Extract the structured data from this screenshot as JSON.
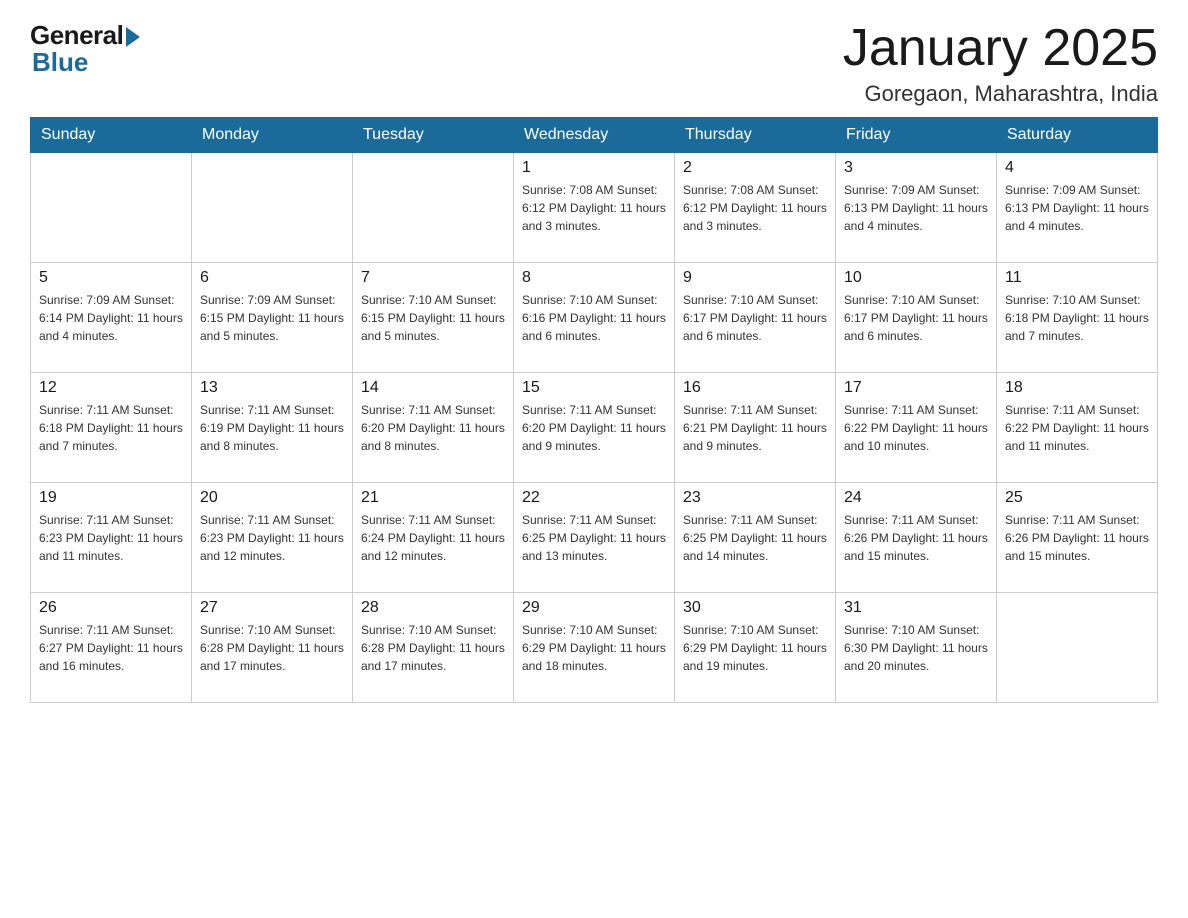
{
  "header": {
    "logo_general": "General",
    "logo_blue": "Blue",
    "title": "January 2025",
    "location": "Goregaon, Maharashtra, India"
  },
  "weekdays": [
    "Sunday",
    "Monday",
    "Tuesday",
    "Wednesday",
    "Thursday",
    "Friday",
    "Saturday"
  ],
  "weeks": [
    [
      {
        "day": "",
        "info": ""
      },
      {
        "day": "",
        "info": ""
      },
      {
        "day": "",
        "info": ""
      },
      {
        "day": "1",
        "info": "Sunrise: 7:08 AM\nSunset: 6:12 PM\nDaylight: 11 hours and 3 minutes."
      },
      {
        "day": "2",
        "info": "Sunrise: 7:08 AM\nSunset: 6:12 PM\nDaylight: 11 hours and 3 minutes."
      },
      {
        "day": "3",
        "info": "Sunrise: 7:09 AM\nSunset: 6:13 PM\nDaylight: 11 hours and 4 minutes."
      },
      {
        "day": "4",
        "info": "Sunrise: 7:09 AM\nSunset: 6:13 PM\nDaylight: 11 hours and 4 minutes."
      }
    ],
    [
      {
        "day": "5",
        "info": "Sunrise: 7:09 AM\nSunset: 6:14 PM\nDaylight: 11 hours and 4 minutes."
      },
      {
        "day": "6",
        "info": "Sunrise: 7:09 AM\nSunset: 6:15 PM\nDaylight: 11 hours and 5 minutes."
      },
      {
        "day": "7",
        "info": "Sunrise: 7:10 AM\nSunset: 6:15 PM\nDaylight: 11 hours and 5 minutes."
      },
      {
        "day": "8",
        "info": "Sunrise: 7:10 AM\nSunset: 6:16 PM\nDaylight: 11 hours and 6 minutes."
      },
      {
        "day": "9",
        "info": "Sunrise: 7:10 AM\nSunset: 6:17 PM\nDaylight: 11 hours and 6 minutes."
      },
      {
        "day": "10",
        "info": "Sunrise: 7:10 AM\nSunset: 6:17 PM\nDaylight: 11 hours and 6 minutes."
      },
      {
        "day": "11",
        "info": "Sunrise: 7:10 AM\nSunset: 6:18 PM\nDaylight: 11 hours and 7 minutes."
      }
    ],
    [
      {
        "day": "12",
        "info": "Sunrise: 7:11 AM\nSunset: 6:18 PM\nDaylight: 11 hours and 7 minutes."
      },
      {
        "day": "13",
        "info": "Sunrise: 7:11 AM\nSunset: 6:19 PM\nDaylight: 11 hours and 8 minutes."
      },
      {
        "day": "14",
        "info": "Sunrise: 7:11 AM\nSunset: 6:20 PM\nDaylight: 11 hours and 8 minutes."
      },
      {
        "day": "15",
        "info": "Sunrise: 7:11 AM\nSunset: 6:20 PM\nDaylight: 11 hours and 9 minutes."
      },
      {
        "day": "16",
        "info": "Sunrise: 7:11 AM\nSunset: 6:21 PM\nDaylight: 11 hours and 9 minutes."
      },
      {
        "day": "17",
        "info": "Sunrise: 7:11 AM\nSunset: 6:22 PM\nDaylight: 11 hours and 10 minutes."
      },
      {
        "day": "18",
        "info": "Sunrise: 7:11 AM\nSunset: 6:22 PM\nDaylight: 11 hours and 11 minutes."
      }
    ],
    [
      {
        "day": "19",
        "info": "Sunrise: 7:11 AM\nSunset: 6:23 PM\nDaylight: 11 hours and 11 minutes."
      },
      {
        "day": "20",
        "info": "Sunrise: 7:11 AM\nSunset: 6:23 PM\nDaylight: 11 hours and 12 minutes."
      },
      {
        "day": "21",
        "info": "Sunrise: 7:11 AM\nSunset: 6:24 PM\nDaylight: 11 hours and 12 minutes."
      },
      {
        "day": "22",
        "info": "Sunrise: 7:11 AM\nSunset: 6:25 PM\nDaylight: 11 hours and 13 minutes."
      },
      {
        "day": "23",
        "info": "Sunrise: 7:11 AM\nSunset: 6:25 PM\nDaylight: 11 hours and 14 minutes."
      },
      {
        "day": "24",
        "info": "Sunrise: 7:11 AM\nSunset: 6:26 PM\nDaylight: 11 hours and 15 minutes."
      },
      {
        "day": "25",
        "info": "Sunrise: 7:11 AM\nSunset: 6:26 PM\nDaylight: 11 hours and 15 minutes."
      }
    ],
    [
      {
        "day": "26",
        "info": "Sunrise: 7:11 AM\nSunset: 6:27 PM\nDaylight: 11 hours and 16 minutes."
      },
      {
        "day": "27",
        "info": "Sunrise: 7:10 AM\nSunset: 6:28 PM\nDaylight: 11 hours and 17 minutes."
      },
      {
        "day": "28",
        "info": "Sunrise: 7:10 AM\nSunset: 6:28 PM\nDaylight: 11 hours and 17 minutes."
      },
      {
        "day": "29",
        "info": "Sunrise: 7:10 AM\nSunset: 6:29 PM\nDaylight: 11 hours and 18 minutes."
      },
      {
        "day": "30",
        "info": "Sunrise: 7:10 AM\nSunset: 6:29 PM\nDaylight: 11 hours and 19 minutes."
      },
      {
        "day": "31",
        "info": "Sunrise: 7:10 AM\nSunset: 6:30 PM\nDaylight: 11 hours and 20 minutes."
      },
      {
        "day": "",
        "info": ""
      }
    ]
  ]
}
